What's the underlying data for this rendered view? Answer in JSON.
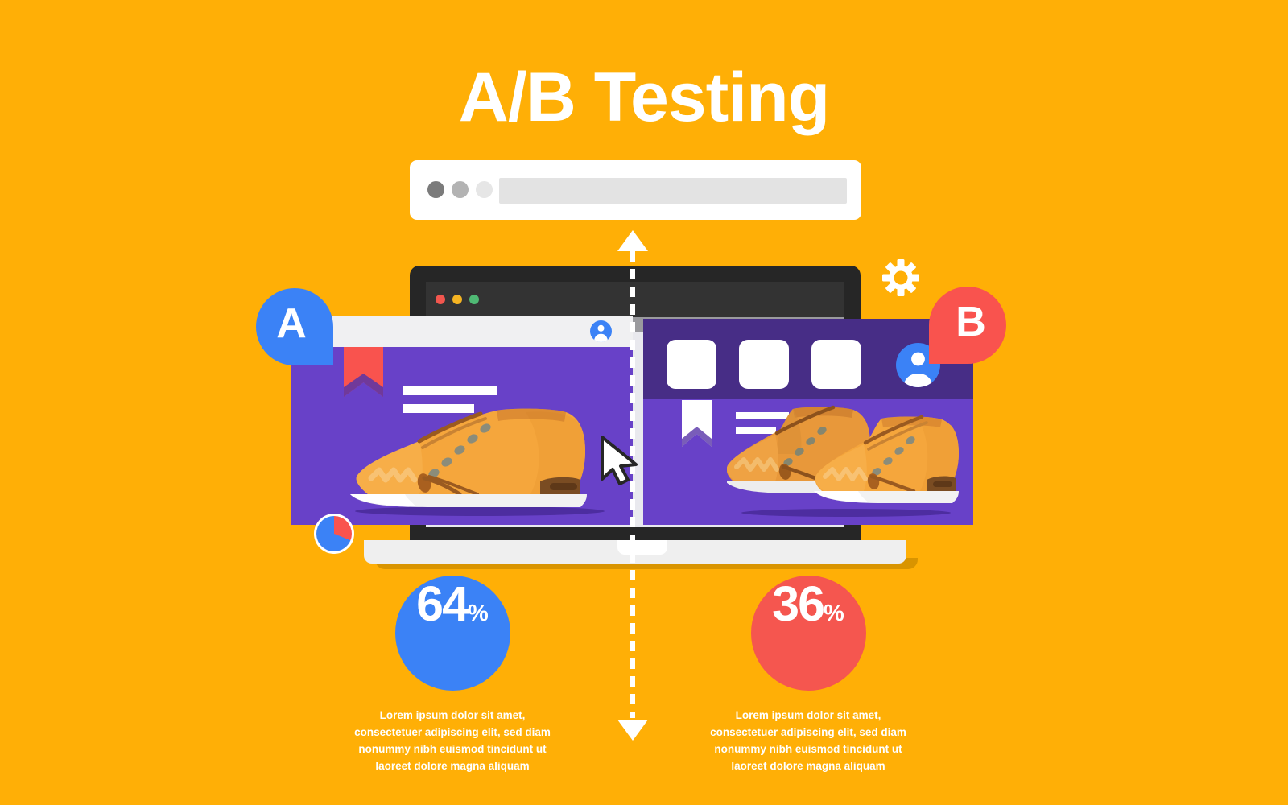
{
  "page": {
    "title": "A/B Testing",
    "background_color": "#FFAF06"
  },
  "colors": {
    "background": "#FFAF06",
    "purple": "#6841C8",
    "purple_dark": "#472D86",
    "blue": "#3B82F6",
    "red": "#F9534E",
    "white": "#FFFFFF",
    "laptop_dark": "#262626",
    "shoe_orange": "#F5A63C",
    "shoe_brown": "#8B5A2B"
  },
  "url_bar": {
    "name": "browser-url-bar",
    "dots": [
      "dark",
      "medium",
      "light"
    ],
    "field_value": "",
    "field_placeholder": ""
  },
  "laptop": {
    "name": "laptop-mockup",
    "window_dots": [
      "red",
      "yellow",
      "green"
    ]
  },
  "divider": {
    "name": "ab-split-divider",
    "style": "dashed",
    "arrow_top": "up",
    "arrow_bottom": "down"
  },
  "variant_a": {
    "badge_label": "A",
    "badge_color": "#3B82F6",
    "bookmark_icon": "ribbon-bookmark-icon",
    "bookmark_color": "#F9534E",
    "avatar_icon": "user-avatar-icon",
    "text_lines": 2,
    "product_icon": "sneaker-single-icon",
    "card_color": "#6841C8"
  },
  "variant_b": {
    "badge_label": "B",
    "badge_color": "#F9534E",
    "bookmark_icon": "ribbon-bookmark-icon",
    "bookmark_color": "#FFFFFF",
    "avatar_icon": "user-avatar-icon",
    "tiles": 3,
    "text_lines": 2,
    "product_icon": "sneaker-pair-icon",
    "card_color": "#6841C8",
    "header_color": "#472D86"
  },
  "gear": {
    "icon": "gear-settings-icon",
    "color": "#FFFFFF"
  },
  "pie_badge": {
    "icon": "pie-chart-icon",
    "slices": [
      {
        "label": "A",
        "value": 69,
        "color": "#3B82F6"
      },
      {
        "label": "B",
        "value": 31,
        "color": "#F9534E"
      }
    ]
  },
  "cursor": {
    "icon": "mouse-pointer-icon"
  },
  "stats": [
    {
      "name": "stat-a",
      "value": "64",
      "unit": "%",
      "color": "#3B82F6",
      "caption": "Lorem ipsum dolor sit amet, consectetuer adipiscing elit, sed diam nonummy nibh euismod tincidunt ut laoreet dolore magna aliquam"
    },
    {
      "name": "stat-b",
      "value": "36",
      "unit": "%",
      "color": "#F5564F",
      "caption": "Lorem ipsum dolor sit amet, consectetuer adipiscing elit, sed diam nonummy nibh euismod tincidunt ut laoreet dolore magna aliquam"
    }
  ],
  "chart_data": {
    "type": "pie",
    "title": "A/B Testing",
    "categories": [
      "A",
      "B"
    ],
    "values": [
      64,
      36
    ],
    "unit": "%",
    "colors": [
      "#3B82F6",
      "#F5564F"
    ],
    "legend_position": "below",
    "grid": false
  }
}
